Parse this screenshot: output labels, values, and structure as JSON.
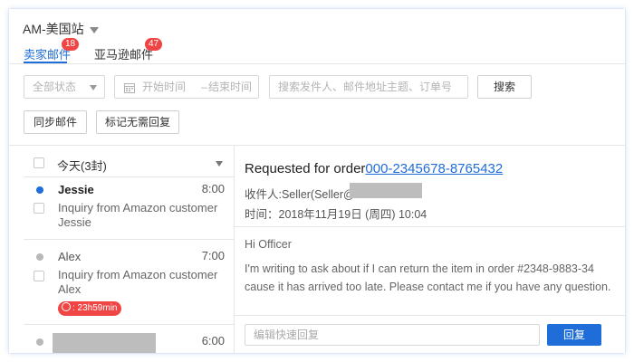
{
  "store": {
    "name": "AM-美国站"
  },
  "tabs": [
    {
      "label": "卖家邮件",
      "badge": "18"
    },
    {
      "label": "亚马逊邮件",
      "badge": "47"
    }
  ],
  "filters": {
    "status_value": "全部状态",
    "start_placeholder": "开始时间",
    "range_separator": "–",
    "end_placeholder": "结束时间",
    "search_placeholder": "搜索发件人、邮件地址主题、订单号",
    "search_label": "搜索"
  },
  "actions": {
    "sync_label": "同步邮件",
    "mark_label": "标记无需回复"
  },
  "list": {
    "group_label": "今天(3封)",
    "items": [
      {
        "sender": "Jessie",
        "time": "8:00",
        "subject": "Inquiry from Amazon customer Jessie",
        "unread": true
      },
      {
        "sender": "Alex",
        "time": "7:00",
        "subject": "Inquiry from Amazon customer Alex",
        "timer": ": 23h59min",
        "unread": false
      },
      {
        "sender": "",
        "time": "6:00",
        "unread": false
      }
    ]
  },
  "detail": {
    "subject_prefix": "Requested for order",
    "order_number": "000-2345678-8765432",
    "recipient_label": "收件人:Seller(Seller@",
    "time_label": "时间：2018年11月19日 (周四) 10:04",
    "greeting": "Hi Officer",
    "body": "I'm writing to ask about if I can return the item in order #2348-9883-34 cause it has arrived too late. Please contact me if you have any question.",
    "reply_placeholder": "编辑快速回复",
    "reply_button": "回复"
  },
  "colors": {
    "accent": "#1f6dd8",
    "badge": "#f04545",
    "redaction": "#bdbdbd"
  }
}
